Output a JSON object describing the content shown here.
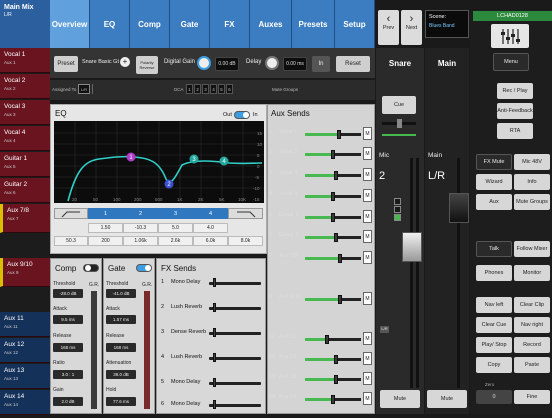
{
  "mix_header": {
    "title": "Main Mix",
    "sub": "L/R"
  },
  "channels": [
    {
      "name": "Vocal 1",
      "sub": "Aux 1"
    },
    {
      "name": "Vocal 2",
      "sub": "Aux 2"
    },
    {
      "name": "Vocal 3",
      "sub": "Aux 3"
    },
    {
      "name": "Vocal 4",
      "sub": "Aux 4"
    },
    {
      "name": "Guitar 1",
      "sub": "Aux 5"
    },
    {
      "name": "Guitar 2",
      "sub": "Aux 6"
    },
    {
      "name": "Aux 7/8",
      "sub": "Aux 7"
    },
    {
      "name": "Aux 9/10",
      "sub": "Aux 9"
    },
    {
      "name": "Aux 11",
      "sub": "Aux 11"
    },
    {
      "name": "Aux 12",
      "sub": "Aux 12"
    },
    {
      "name": "Aux 13",
      "sub": "Aux 13"
    },
    {
      "name": "Aux 14",
      "sub": "Aux 14"
    }
  ],
  "tabs": [
    "Overview",
    "EQ",
    "Comp",
    "Gate",
    "FX",
    "Auxes",
    "Presets",
    "Setup"
  ],
  "nav": {
    "prev": "Prev",
    "next": "Next"
  },
  "scene": {
    "label": "Scene:",
    "name": "Blues Band"
  },
  "device": {
    "name": "LCHAD0128"
  },
  "right_buttons": {
    "menu": "Menu",
    "rec_play": "Rec / Play",
    "anti_feedback": "Anti-Feedback",
    "rta": "RTA",
    "fx_mute": "FX Mute",
    "mic48v": "Mic 48V",
    "wizard": "Wizard",
    "info": "Info",
    "aux": "Aux",
    "mute_groups": "Mute Groups",
    "talk": "Talk",
    "follow_mixer": "Follow Mixer",
    "phones": "Phones",
    "monitor": "Monitor",
    "nav_left": "Nav left",
    "clear_clip": "Clear Clip",
    "clear_cue": "Clear Cue",
    "nav_right": "Nav right",
    "play_stop": "Play/ Stop",
    "record": "Record",
    "copy": "Copy",
    "paste": "Paste",
    "zero_label": "Zero",
    "zero_value": "0",
    "fine": "Fine"
  },
  "preset": {
    "label": "Preset",
    "name": "Snare Basic Gt",
    "polarity": "Polarity Reverse",
    "digital_gain_label": "Digital Gain",
    "digital_gain": "0.00 dB",
    "delay_label": "Delay",
    "delay": "0.00 ms",
    "in": "In",
    "reset": "Reset"
  },
  "assign": {
    "assigned_to": "Assigned To",
    "lr": "L/R",
    "dca": "DCA",
    "dca_nums": [
      "1",
      "2",
      "3",
      "4",
      "5",
      "6"
    ],
    "mute_groups": "Mute Groups"
  },
  "eq": {
    "title": "EQ",
    "out": "Out",
    "in": "In",
    "freq_ticks": [
      "20",
      "50",
      "100",
      "200",
      "500",
      "1K",
      "2K",
      "5K",
      "10K",
      "20K"
    ],
    "gain_ticks": [
      "15",
      "10",
      "5",
      "0",
      "-5",
      "-10",
      "-15"
    ],
    "bands": [
      "1",
      "2",
      "3",
      "4"
    ],
    "gains": [
      "1.50",
      "-10.3",
      "5.0",
      "4.0"
    ],
    "freqs": [
      "50.3",
      "200",
      "1.06k",
      "2.6k",
      "6.0k",
      "8.0k"
    ]
  },
  "comp": {
    "title": "Comp",
    "gr": "G.R.",
    "threshold_label": "Threshold",
    "threshold": "-28.0 dB",
    "attack_label": "Attack",
    "attack": "9.5 ms",
    "release_label": "Release",
    "release": "168 ms",
    "ratio_label": "Ratio",
    "ratio": "3.0 : 1",
    "gain_label": "Gain",
    "gain": "2.0 dB",
    "enabled": false
  },
  "gate": {
    "title": "Gate",
    "gr": "G.R.",
    "threshold_label": "Threshold",
    "threshold": "-41.0 dB",
    "attack_label": "Attack",
    "attack": "1.57 ms",
    "release_label": "Release",
    "release": "168 ms",
    "attenuation_label": "Attenuation",
    "attenuation": "39.0 dB",
    "hold_label": "Hold",
    "hold": "77.6 ms",
    "enabled": true
  },
  "fx_sends": {
    "title": "FX Sends",
    "items": [
      {
        "num": "1",
        "name": "Mono Delay"
      },
      {
        "num": "2",
        "name": "Lush Reverb"
      },
      {
        "num": "3",
        "name": "Dense Reverb"
      },
      {
        "num": "4",
        "name": "Lush Reverb"
      },
      {
        "num": "5",
        "name": "Mono Delay"
      },
      {
        "num": "6",
        "name": "Mono Delay"
      }
    ]
  },
  "aux_sends": {
    "title": "Aux Sends",
    "mute": "M",
    "lcr": "L C R",
    "items": [
      {
        "num": "1",
        "name": "Vocal 1",
        "level": 0.6
      },
      {
        "num": "2",
        "name": "Vocal 2",
        "level": 0.5
      },
      {
        "num": "3",
        "name": "Vocal 3",
        "level": 0.55
      },
      {
        "num": "4",
        "name": "Vocal 4",
        "level": 0.5
      },
      {
        "num": "5",
        "name": "Guitar 1",
        "level": 0.5
      },
      {
        "num": "6",
        "name": "Guitar 2",
        "level": 0.55
      },
      {
        "num": "7",
        "name": "Aux 7/8",
        "level": 0.62
      },
      {
        "num": "9",
        "name": "Aux 9/10",
        "level": 0.62
      },
      {
        "num": "11",
        "name": "Aux 11",
        "level": 0.4
      },
      {
        "num": "12",
        "name": "Aux 12",
        "level": 0.55
      },
      {
        "num": "13",
        "name": "Aux 13",
        "level": 0.55
      },
      {
        "num": "14",
        "name": "Aux 14",
        "level": 0.5
      }
    ]
  },
  "strip_snare": {
    "name": "Snare",
    "cue": "Cue",
    "mic": "Mic",
    "mic_num": "2",
    "lr": "L/R",
    "mute": "Mute"
  },
  "strip_main": {
    "name": "Main",
    "main_label": "Main",
    "lr": "L/R",
    "mute": "Mute"
  },
  "colors": {
    "accent": "#3c7cc0",
    "active_tab": "#5fa0dd",
    "channel_red": "#6a1420",
    "aux_blue": "#14315a",
    "ip_green": "#2c8a3c"
  }
}
